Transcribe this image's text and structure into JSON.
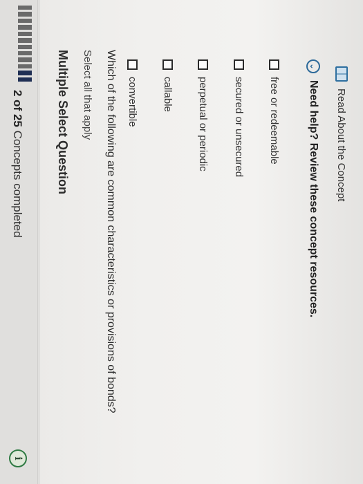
{
  "header": {
    "progress_count": "2 of 25",
    "progress_suffix": "Concepts completed",
    "info_icon": "info-icon"
  },
  "question": {
    "title": "Multiple Select Question",
    "subtitle": "Select all that apply",
    "prompt": "Which of the following are common characteristics or provisions of bonds?",
    "options": [
      {
        "label": "convertible"
      },
      {
        "label": "callable"
      },
      {
        "label": "perpetual or periodic"
      },
      {
        "label": "secured or unsecured"
      },
      {
        "label": "free or redeemable"
      }
    ]
  },
  "help": {
    "label": "Need help? Review these concept resources.",
    "icon": "chevron-circle-icon"
  },
  "resource": {
    "label": "Read About the Concept",
    "icon": "book-icon"
  }
}
